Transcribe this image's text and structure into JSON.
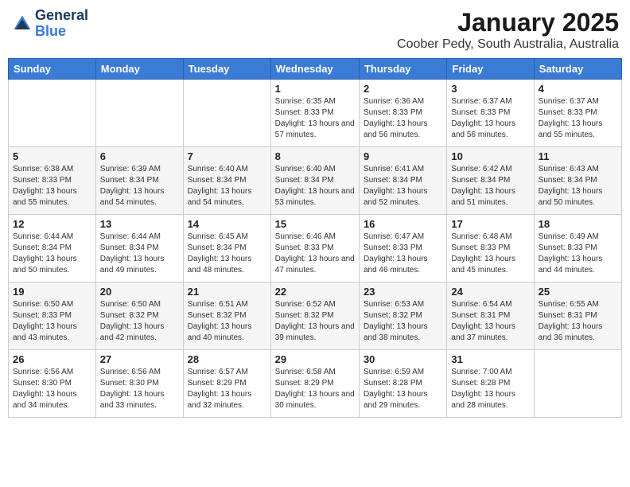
{
  "header": {
    "logo_line1": "General",
    "logo_line2": "Blue",
    "month": "January 2025",
    "location": "Coober Pedy, South Australia, Australia"
  },
  "weekdays": [
    "Sunday",
    "Monday",
    "Tuesday",
    "Wednesday",
    "Thursday",
    "Friday",
    "Saturday"
  ],
  "weeks": [
    [
      {
        "day": "",
        "info": ""
      },
      {
        "day": "",
        "info": ""
      },
      {
        "day": "",
        "info": ""
      },
      {
        "day": "1",
        "info": "Sunrise: 6:35 AM\nSunset: 8:33 PM\nDaylight: 13 hours\nand 57 minutes."
      },
      {
        "day": "2",
        "info": "Sunrise: 6:36 AM\nSunset: 8:33 PM\nDaylight: 13 hours\nand 56 minutes."
      },
      {
        "day": "3",
        "info": "Sunrise: 6:37 AM\nSunset: 8:33 PM\nDaylight: 13 hours\nand 56 minutes."
      },
      {
        "day": "4",
        "info": "Sunrise: 6:37 AM\nSunset: 8:33 PM\nDaylight: 13 hours\nand 55 minutes."
      }
    ],
    [
      {
        "day": "5",
        "info": "Sunrise: 6:38 AM\nSunset: 8:33 PM\nDaylight: 13 hours\nand 55 minutes."
      },
      {
        "day": "6",
        "info": "Sunrise: 6:39 AM\nSunset: 8:34 PM\nDaylight: 13 hours\nand 54 minutes."
      },
      {
        "day": "7",
        "info": "Sunrise: 6:40 AM\nSunset: 8:34 PM\nDaylight: 13 hours\nand 54 minutes."
      },
      {
        "day": "8",
        "info": "Sunrise: 6:40 AM\nSunset: 8:34 PM\nDaylight: 13 hours\nand 53 minutes."
      },
      {
        "day": "9",
        "info": "Sunrise: 6:41 AM\nSunset: 8:34 PM\nDaylight: 13 hours\nand 52 minutes."
      },
      {
        "day": "10",
        "info": "Sunrise: 6:42 AM\nSunset: 8:34 PM\nDaylight: 13 hours\nand 51 minutes."
      },
      {
        "day": "11",
        "info": "Sunrise: 6:43 AM\nSunset: 8:34 PM\nDaylight: 13 hours\nand 50 minutes."
      }
    ],
    [
      {
        "day": "12",
        "info": "Sunrise: 6:44 AM\nSunset: 8:34 PM\nDaylight: 13 hours\nand 50 minutes."
      },
      {
        "day": "13",
        "info": "Sunrise: 6:44 AM\nSunset: 8:34 PM\nDaylight: 13 hours\nand 49 minutes."
      },
      {
        "day": "14",
        "info": "Sunrise: 6:45 AM\nSunset: 8:34 PM\nDaylight: 13 hours\nand 48 minutes."
      },
      {
        "day": "15",
        "info": "Sunrise: 6:46 AM\nSunset: 8:33 PM\nDaylight: 13 hours\nand 47 minutes."
      },
      {
        "day": "16",
        "info": "Sunrise: 6:47 AM\nSunset: 8:33 PM\nDaylight: 13 hours\nand 46 minutes."
      },
      {
        "day": "17",
        "info": "Sunrise: 6:48 AM\nSunset: 8:33 PM\nDaylight: 13 hours\nand 45 minutes."
      },
      {
        "day": "18",
        "info": "Sunrise: 6:49 AM\nSunset: 8:33 PM\nDaylight: 13 hours\nand 44 minutes."
      }
    ],
    [
      {
        "day": "19",
        "info": "Sunrise: 6:50 AM\nSunset: 8:33 PM\nDaylight: 13 hours\nand 43 minutes."
      },
      {
        "day": "20",
        "info": "Sunrise: 6:50 AM\nSunset: 8:32 PM\nDaylight: 13 hours\nand 42 minutes."
      },
      {
        "day": "21",
        "info": "Sunrise: 6:51 AM\nSunset: 8:32 PM\nDaylight: 13 hours\nand 40 minutes."
      },
      {
        "day": "22",
        "info": "Sunrise: 6:52 AM\nSunset: 8:32 PM\nDaylight: 13 hours\nand 39 minutes."
      },
      {
        "day": "23",
        "info": "Sunrise: 6:53 AM\nSunset: 8:32 PM\nDaylight: 13 hours\nand 38 minutes."
      },
      {
        "day": "24",
        "info": "Sunrise: 6:54 AM\nSunset: 8:31 PM\nDaylight: 13 hours\nand 37 minutes."
      },
      {
        "day": "25",
        "info": "Sunrise: 6:55 AM\nSunset: 8:31 PM\nDaylight: 13 hours\nand 36 minutes."
      }
    ],
    [
      {
        "day": "26",
        "info": "Sunrise: 6:56 AM\nSunset: 8:30 PM\nDaylight: 13 hours\nand 34 minutes."
      },
      {
        "day": "27",
        "info": "Sunrise: 6:56 AM\nSunset: 8:30 PM\nDaylight: 13 hours\nand 33 minutes."
      },
      {
        "day": "28",
        "info": "Sunrise: 6:57 AM\nSunset: 8:29 PM\nDaylight: 13 hours\nand 32 minutes."
      },
      {
        "day": "29",
        "info": "Sunrise: 6:58 AM\nSunset: 8:29 PM\nDaylight: 13 hours\nand 30 minutes."
      },
      {
        "day": "30",
        "info": "Sunrise: 6:59 AM\nSunset: 8:28 PM\nDaylight: 13 hours\nand 29 minutes."
      },
      {
        "day": "31",
        "info": "Sunrise: 7:00 AM\nSunset: 8:28 PM\nDaylight: 13 hours\nand 28 minutes."
      },
      {
        "day": "",
        "info": ""
      }
    ]
  ]
}
